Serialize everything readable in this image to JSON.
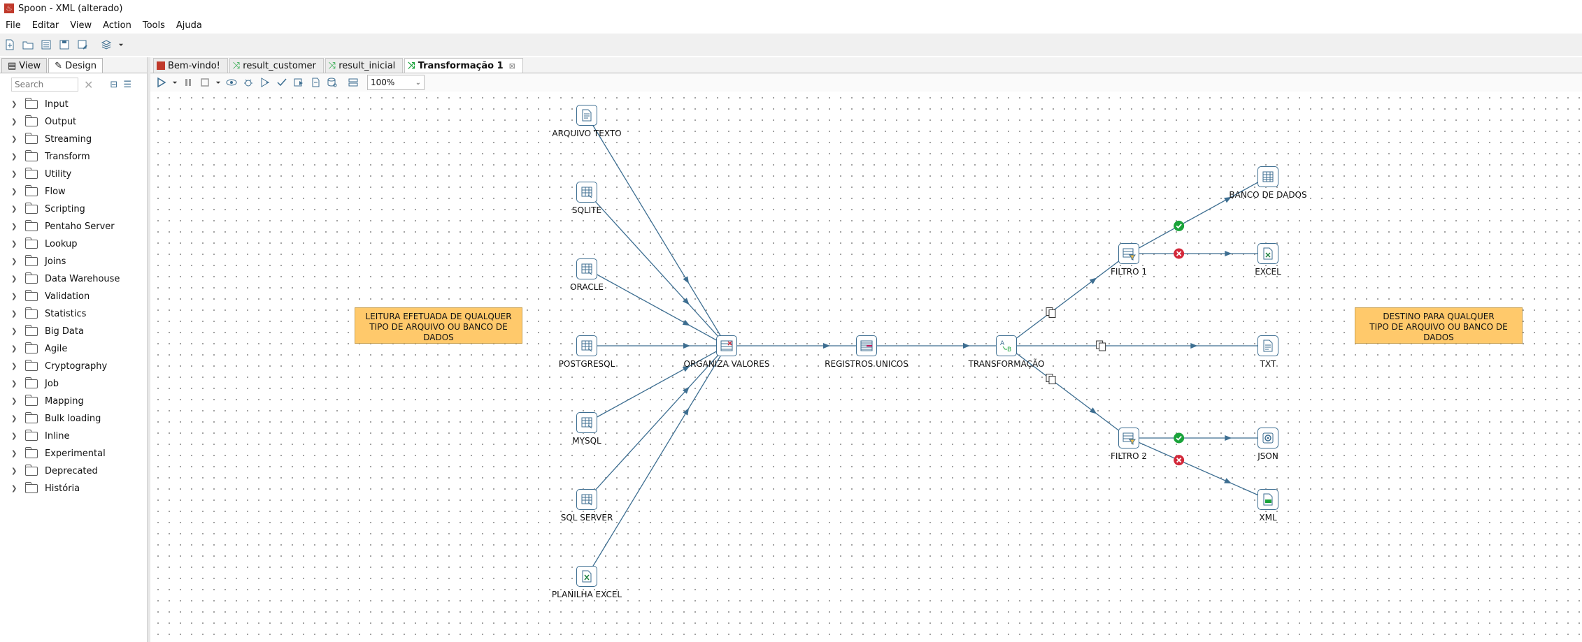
{
  "window": {
    "title": "Spoon - XML (alterado)"
  },
  "menu": [
    "File",
    "Editar",
    "View",
    "Action",
    "Tools",
    "Ajuda"
  ],
  "left_panel": {
    "tabs": [
      {
        "label": "View"
      },
      {
        "label": "Design"
      }
    ],
    "search": {
      "placeholder": "Search"
    },
    "categories": [
      "Input",
      "Output",
      "Streaming",
      "Transform",
      "Utility",
      "Flow",
      "Scripting",
      "Pentaho Server",
      "Lookup",
      "Joins",
      "Data Warehouse",
      "Validation",
      "Statistics",
      "Big Data",
      "Agile",
      "Cryptography",
      "Job",
      "Mapping",
      "Bulk loading",
      "Inline",
      "Experimental",
      "Deprecated",
      "História"
    ]
  },
  "editor_tabs": [
    {
      "label": "Bem-vindo!",
      "icon": "spoon-icon"
    },
    {
      "label": "result_customer",
      "icon": "transformation-icon"
    },
    {
      "label": "result_inicial",
      "icon": "transformation-icon"
    },
    {
      "label": "Transformação 1",
      "icon": "transformation-icon",
      "active": true
    }
  ],
  "editor_toolbar": {
    "zoom": "100%"
  },
  "canvas": {
    "notes": [
      {
        "lines": [
          "LEITURA EFETUADA DE QUALQUER",
          "TIPO DE ARQUIVO OU BANCO DE DADOS"
        ]
      },
      {
        "lines": [
          "DESTINO PARA QUALQUER",
          "TIPO DE ARQUIVO OU BANCO DE DADOS"
        ]
      }
    ],
    "steps": [
      {
        "label": "ARQUIVO TEXTO",
        "icon": "text-file-input-icon"
      },
      {
        "label": "SQLITE",
        "icon": "table-input-icon"
      },
      {
        "label": "ORACLE",
        "icon": "table-input-icon"
      },
      {
        "label": "POSTGRESQL",
        "icon": "table-input-icon"
      },
      {
        "label": "MYSQL",
        "icon": "table-input-icon"
      },
      {
        "label": "SQL SERVER",
        "icon": "table-input-icon"
      },
      {
        "label": "PLANILHA EXCEL",
        "icon": "excel-input-icon"
      },
      {
        "label": "ORGANIZA VALORES",
        "icon": "select-values-icon"
      },
      {
        "label": "REGISTROS UNICOS",
        "icon": "unique-rows-icon"
      },
      {
        "label": "TRANSFORMAÇÃO",
        "icon": "replace-string-icon"
      },
      {
        "label": "FILTRO 1",
        "icon": "filter-rows-icon"
      },
      {
        "label": "FILTRO 2",
        "icon": "filter-rows-icon"
      },
      {
        "label": "BANCO DE DADOS",
        "icon": "table-output-icon"
      },
      {
        "label": "EXCEL",
        "icon": "excel-output-icon"
      },
      {
        "label": "TXT",
        "icon": "text-file-output-icon"
      },
      {
        "label": "JSON",
        "icon": "json-output-icon"
      },
      {
        "label": "XML",
        "icon": "xml-output-icon"
      }
    ],
    "hops": [
      {
        "from": "ARQUIVO TEXTO",
        "to": "ORGANIZA VALORES"
      },
      {
        "from": "SQLITE",
        "to": "ORGANIZA VALORES"
      },
      {
        "from": "ORACLE",
        "to": "ORGANIZA VALORES"
      },
      {
        "from": "POSTGRESQL",
        "to": "ORGANIZA VALORES"
      },
      {
        "from": "MYSQL",
        "to": "ORGANIZA VALORES"
      },
      {
        "from": "SQL SERVER",
        "to": "ORGANIZA VALORES"
      },
      {
        "from": "PLANILHA EXCEL",
        "to": "ORGANIZA VALORES"
      },
      {
        "from": "ORGANIZA VALORES",
        "to": "REGISTROS UNICOS"
      },
      {
        "from": "REGISTROS UNICOS",
        "to": "TRANSFORMAÇÃO"
      },
      {
        "from": "TRANSFORMAÇÃO",
        "to": "FILTRO 1",
        "type": "copy"
      },
      {
        "from": "TRANSFORMAÇÃO",
        "to": "TXT",
        "type": "copy"
      },
      {
        "from": "TRANSFORMAÇÃO",
        "to": "FILTRO 2",
        "type": "copy"
      },
      {
        "from": "FILTRO 1",
        "to": "BANCO DE DADOS",
        "type": "true"
      },
      {
        "from": "FILTRO 1",
        "to": "EXCEL",
        "type": "false"
      },
      {
        "from": "FILTRO 2",
        "to": "JSON",
        "type": "true"
      },
      {
        "from": "FILTRO 2",
        "to": "XML",
        "type": "false"
      }
    ]
  },
  "colors": {
    "hop": "#3d6e91",
    "note": "#ffc96b",
    "true_hop": "#1aa33a",
    "false_hop": "#d3283a"
  }
}
